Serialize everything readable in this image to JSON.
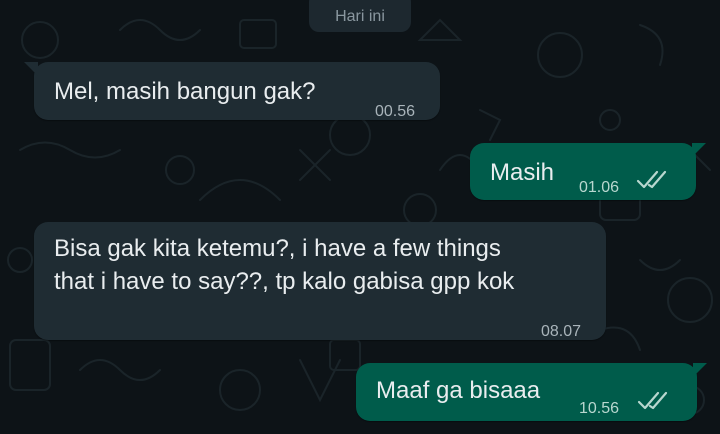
{
  "date_separator": "Hari ini",
  "messages": [
    {
      "direction": "incoming",
      "text": "Mel, masih bangun gak?",
      "time": "00.56"
    },
    {
      "direction": "outgoing",
      "text": "Masih",
      "time": "01.06",
      "status": "read"
    },
    {
      "direction": "incoming",
      "lines": [
        "Bisa gak kita ketemu?, i have a few things",
        "that i have to say??, tp kalo gabisa gpp kok"
      ],
      "time": "08.07"
    },
    {
      "direction": "outgoing",
      "text": "Maaf ga bisaaa",
      "time": "10.56",
      "status": "read"
    }
  ],
  "colors": {
    "incoming_bubble": "#1f2c33",
    "outgoing_bubble": "#005c4b",
    "background": "#0d1317"
  },
  "icons": {
    "read_receipt": "double-check-icon"
  }
}
